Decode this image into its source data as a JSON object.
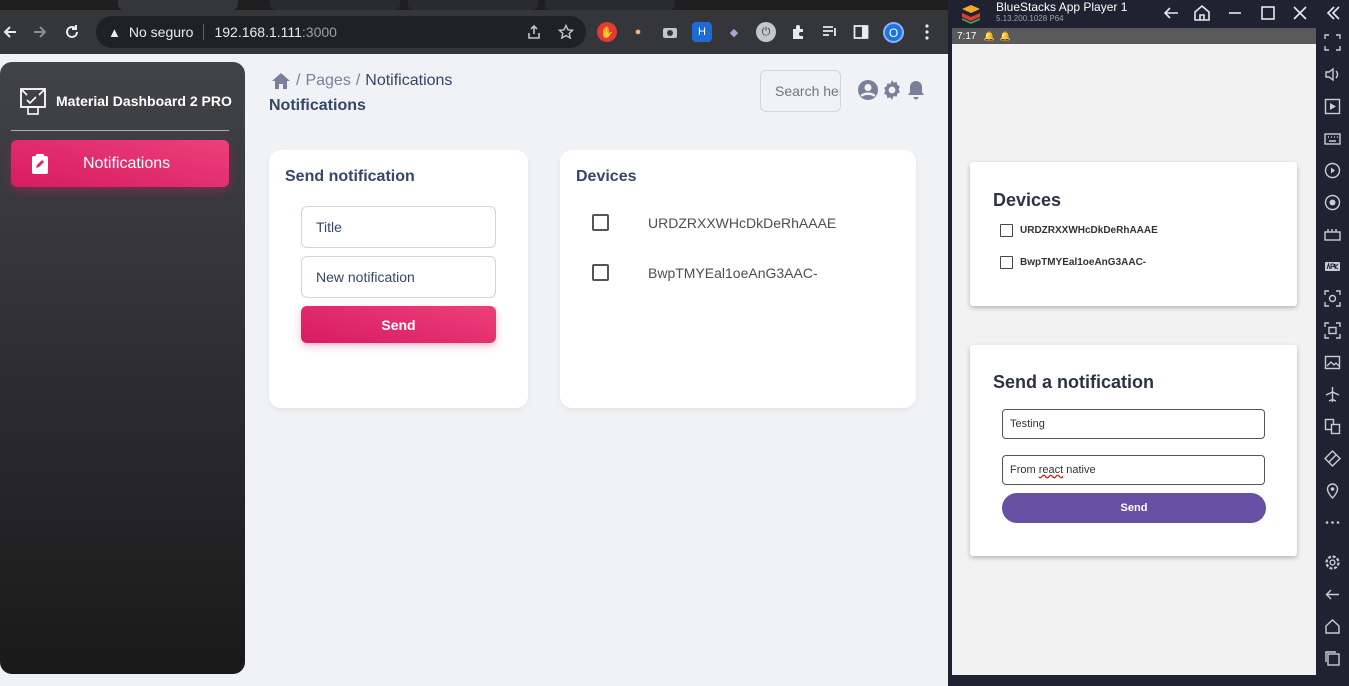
{
  "browser": {
    "address": {
      "security_label": "No seguro",
      "host": "192.168.1.111",
      "port": ":3000"
    },
    "profile_initial": "O"
  },
  "app": {
    "brand": "Material Dashboard 2 PRO",
    "nav": {
      "active_item": "Notifications"
    },
    "breadcrumb": {
      "section": "Pages",
      "current": "Notifications"
    },
    "page_title": "Notifications",
    "search_placeholder": "Search here",
    "send_card": {
      "title": "Send notification",
      "title_value": "Title",
      "body_value": "New notification",
      "send_label": "Send"
    },
    "devices_card": {
      "title": "Devices",
      "devices": [
        "URDZRXXWHcDkDeRhAAAE",
        "BwpTMYEal1oeAnG3AAC-"
      ]
    },
    "accent_color": "#e91e63"
  },
  "bluestacks": {
    "title": "BlueStacks App Player 1",
    "version": "5.13.200.1028  P64",
    "status_time": "7:17",
    "devices_card": {
      "title": "Devices",
      "devices": [
        "URDZRXXWHcDkDeRhAAAE",
        "BwpTMYEal1oeAnG3AAC-"
      ]
    },
    "send_card": {
      "title": "Send a notification",
      "title_value": "Testing",
      "body_prefix": "From ",
      "body_misspelled": "react",
      "body_suffix": " native",
      "send_label": "Send"
    },
    "accent_color": "#6750a4"
  }
}
